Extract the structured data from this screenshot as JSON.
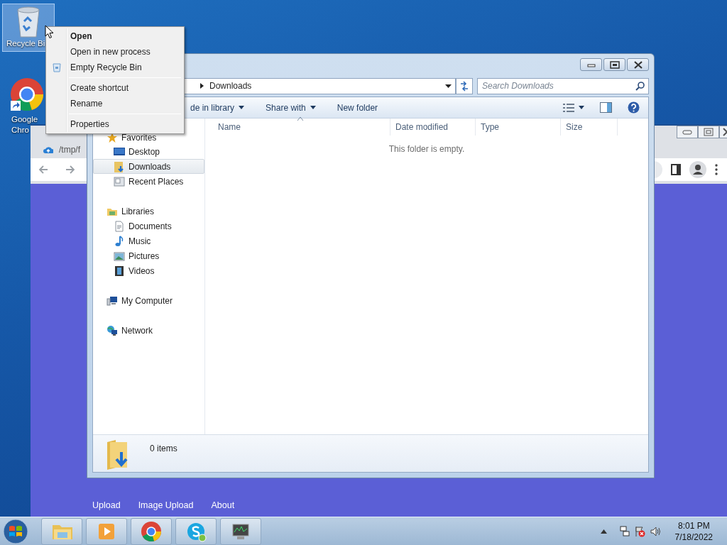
{
  "desktop_icons": [
    {
      "label": "Recycle Bi",
      "kind": "recycle",
      "selected": true
    },
    {
      "label": "Google Chro",
      "kind": "chrome",
      "selected": false
    }
  ],
  "browser": {
    "tab": "/tmp/f",
    "footer_links": [
      "Upload",
      "Image Upload",
      "About"
    ]
  },
  "explorer": {
    "address": "Downloads",
    "search_placeholder": "Search Downloads",
    "toolbar": [
      {
        "label": "de in library",
        "dropdown": true
      },
      {
        "label": "Share with",
        "dropdown": true
      },
      {
        "label": "New folder",
        "dropdown": false
      }
    ],
    "nav": [
      {
        "label": "Favorites",
        "kind": "favorites",
        "selected": false,
        "children": [
          {
            "label": "Desktop",
            "kind": "desktop",
            "selected": false
          },
          {
            "label": "Downloads",
            "kind": "downloads",
            "selected": true
          },
          {
            "label": "Recent Places",
            "kind": "recent",
            "selected": false
          }
        ]
      },
      {
        "label": "Libraries",
        "kind": "libraries",
        "selected": false,
        "children": [
          {
            "label": "Documents",
            "kind": "documents",
            "selected": false
          },
          {
            "label": "Music",
            "kind": "music",
            "selected": false
          },
          {
            "label": "Pictures",
            "kind": "pictures",
            "selected": false
          },
          {
            "label": "Videos",
            "kind": "videos",
            "selected": false
          }
        ]
      },
      {
        "label": "My Computer",
        "kind": "computer",
        "selected": false
      },
      {
        "label": "Network",
        "kind": "network",
        "selected": false
      }
    ],
    "columns": [
      {
        "label": "Name",
        "sorted": true
      },
      {
        "label": "Date modified",
        "sorted": false
      },
      {
        "label": "Type",
        "sorted": false
      },
      {
        "label": "Size",
        "sorted": false
      }
    ],
    "empty_message": "This folder is empty.",
    "status": "0 items"
  },
  "context_menu": [
    {
      "kind": "item",
      "label": "Open",
      "default": true,
      "icon": false
    },
    {
      "kind": "item",
      "label": "Open in new process",
      "default": false,
      "icon": false
    },
    {
      "kind": "item",
      "label": "Empty Recycle Bin",
      "default": false,
      "icon": true
    },
    {
      "kind": "separator"
    },
    {
      "kind": "item",
      "label": "Create shortcut",
      "default": false,
      "icon": false
    },
    {
      "kind": "item",
      "label": "Rename",
      "default": false,
      "icon": false
    },
    {
      "kind": "separator"
    },
    {
      "kind": "item",
      "label": "Properties",
      "default": false,
      "icon": false
    }
  ],
  "taskbar": {
    "apps": [
      {
        "kind": "explorer"
      },
      {
        "kind": "media"
      },
      {
        "kind": "chrome"
      },
      {
        "kind": "skype"
      },
      {
        "kind": "monitor"
      }
    ],
    "time": "8:01 PM",
    "date": "7/18/2022"
  }
}
